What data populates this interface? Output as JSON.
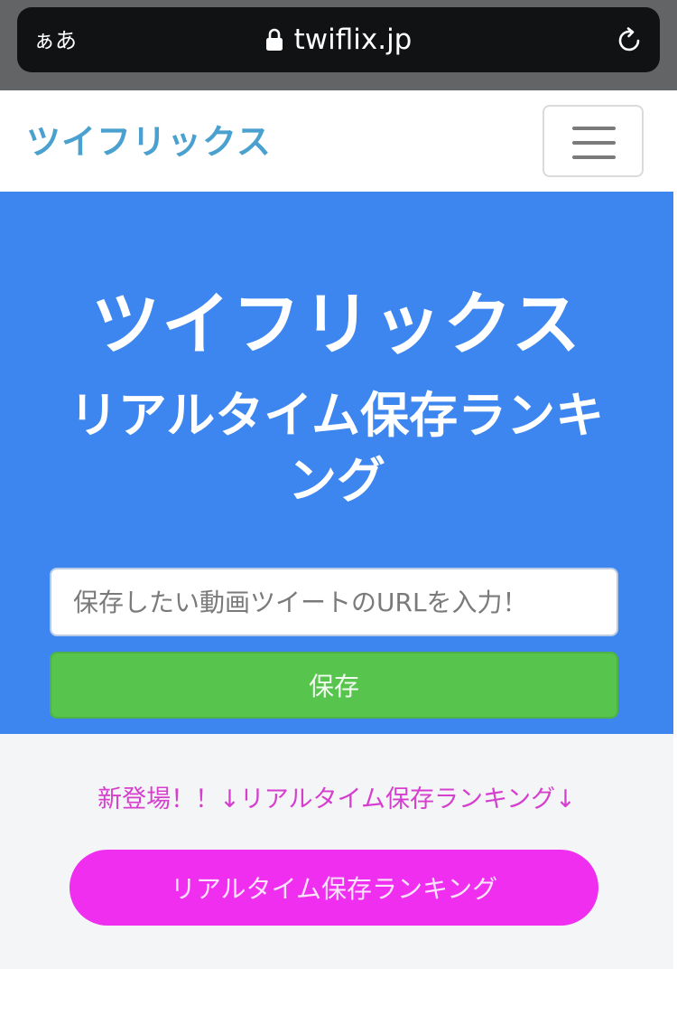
{
  "browser": {
    "reader_toggle": "ぁあ",
    "url": "twiflix.jp",
    "icons": {
      "lock": "lock-icon",
      "reload": "reload-icon"
    }
  },
  "navbar": {
    "brand": "ツイフリックス",
    "menu_icon": "hamburger-icon"
  },
  "hero": {
    "title": "ツイフリックス",
    "subtitle": "リアルタイム保存ランキング",
    "input_placeholder": "保存したい動画ツイートのURLを入力！",
    "input_value": "",
    "save_label": "保存"
  },
  "ranking": {
    "notice": "新登場！！↓リアルタイム保存ランキング↓",
    "button_label": "リアルタイム保存ランキング"
  },
  "colors": {
    "brand": "#4aa1d0",
    "hero_bg": "#3d86ef",
    "save_button": "#56c44d",
    "ranking_accent": "#ef2ef0",
    "notice_text": "#d63fce",
    "section_bg": "#f4f5f7"
  }
}
